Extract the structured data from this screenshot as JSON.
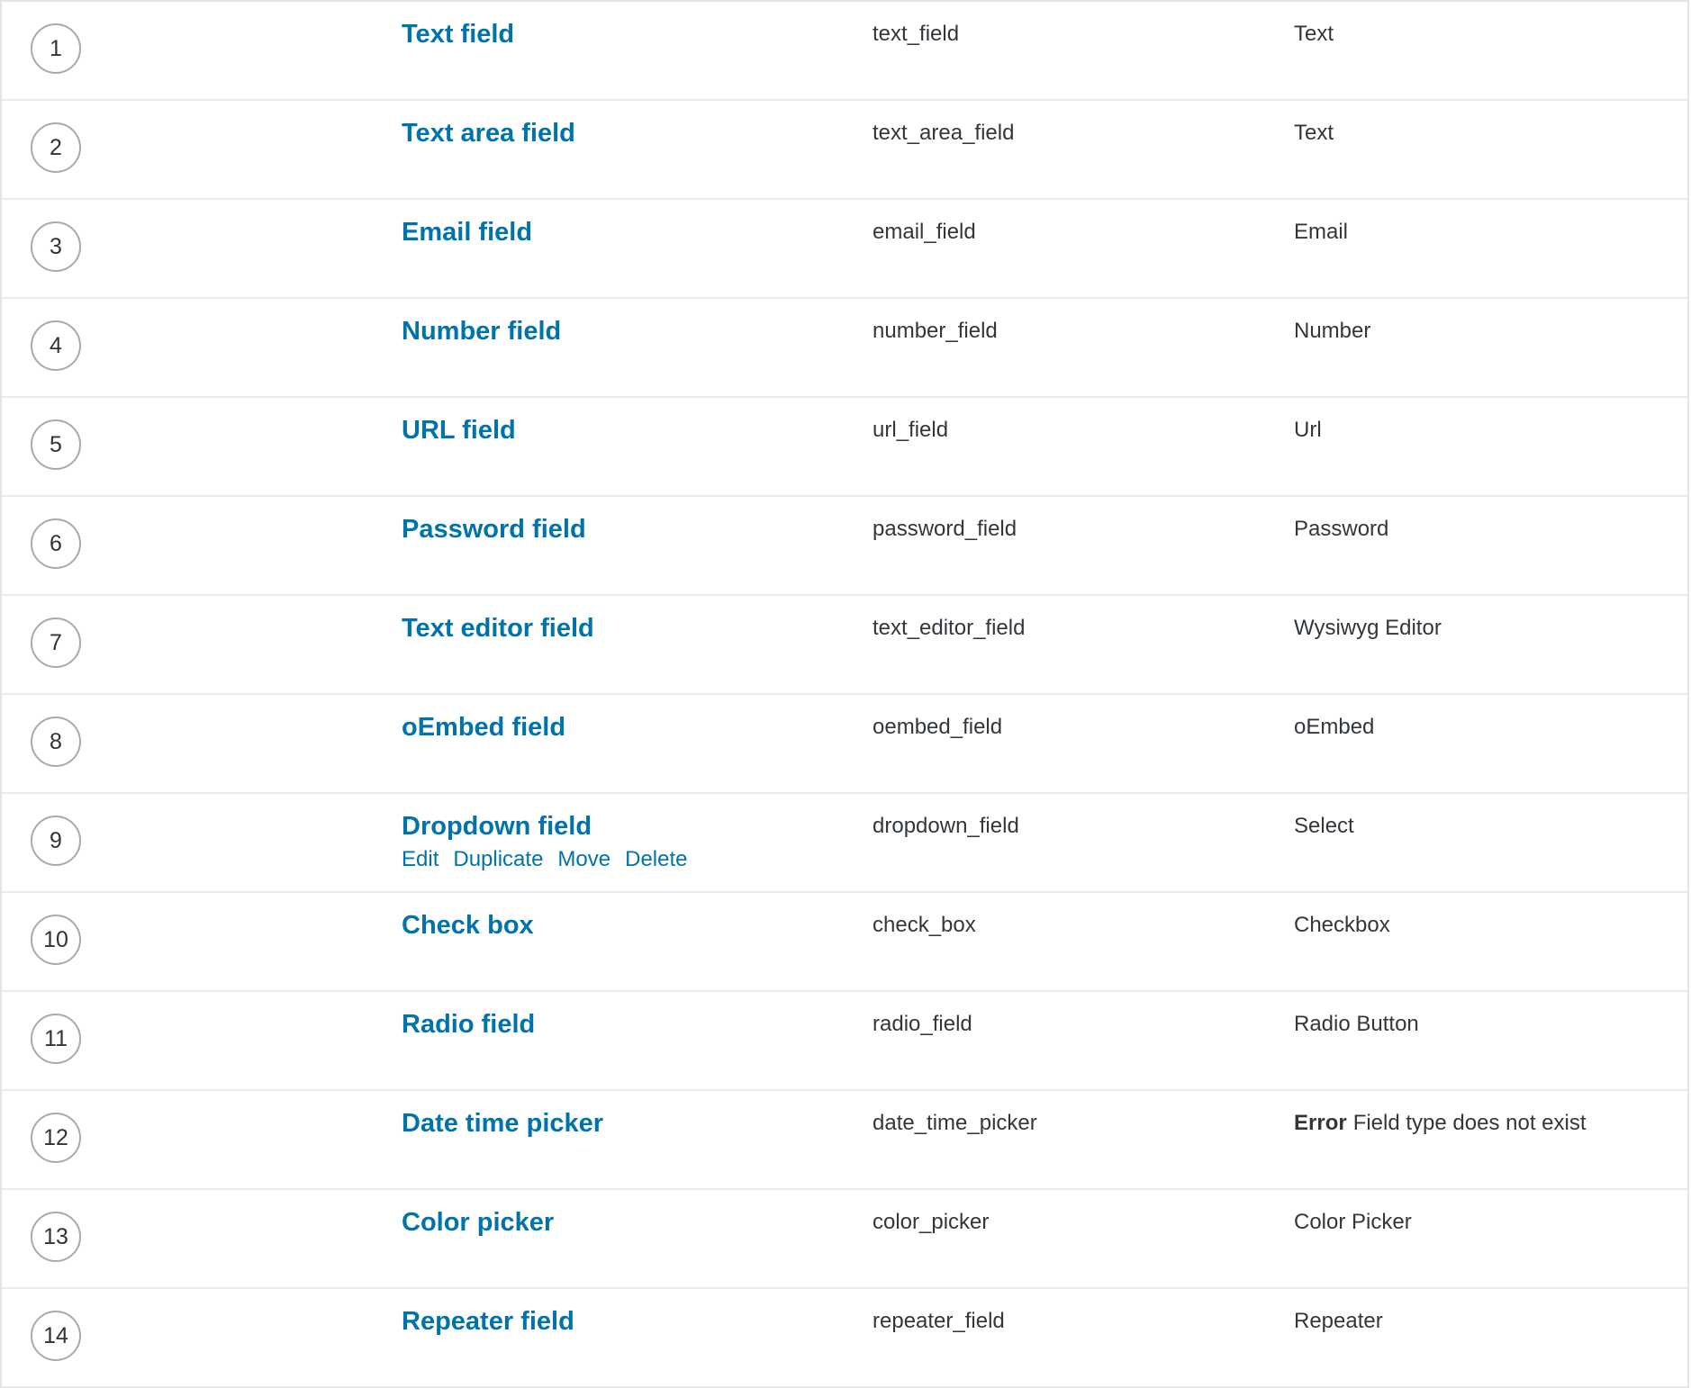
{
  "rows": [
    {
      "order": "1",
      "label": "Text field",
      "name": "text_field",
      "type": "Text"
    },
    {
      "order": "2",
      "label": "Text area field",
      "name": "text_area_field",
      "type": "Text"
    },
    {
      "order": "3",
      "label": "Email field",
      "name": "email_field",
      "type": "Email"
    },
    {
      "order": "4",
      "label": "Number field",
      "name": "number_field",
      "type": "Number"
    },
    {
      "order": "5",
      "label": "URL field",
      "name": "url_field",
      "type": "Url"
    },
    {
      "order": "6",
      "label": "Password field",
      "name": "password_field",
      "type": "Password"
    },
    {
      "order": "7",
      "label": "Text editor field",
      "name": "text_editor_field",
      "type": "Wysiwyg Editor"
    },
    {
      "order": "8",
      "label": "oEmbed field",
      "name": "oembed_field",
      "type": "oEmbed"
    },
    {
      "order": "9",
      "label": "Dropdown field",
      "name": "dropdown_field",
      "type": "Select",
      "actions": [
        "Edit",
        "Duplicate",
        "Move",
        "Delete"
      ]
    },
    {
      "order": "10",
      "label": "Check box",
      "name": "check_box",
      "type": "Checkbox"
    },
    {
      "order": "11",
      "label": "Radio field",
      "name": "radio_field",
      "type": "Radio Button"
    },
    {
      "order": "12",
      "label": "Date time picker",
      "name": "date_time_picker",
      "type_strong": "Error",
      "type": "Field type does not exist"
    },
    {
      "order": "13",
      "label": "Color picker",
      "name": "color_picker",
      "type": "Color Picker"
    },
    {
      "order": "14",
      "label": "Repeater field",
      "name": "repeater_field",
      "type": "Repeater"
    }
  ],
  "colors": {
    "link": "#0073aa",
    "text": "#32373c",
    "border": "#eaeaea",
    "circle_border": "#aaaaaa"
  }
}
